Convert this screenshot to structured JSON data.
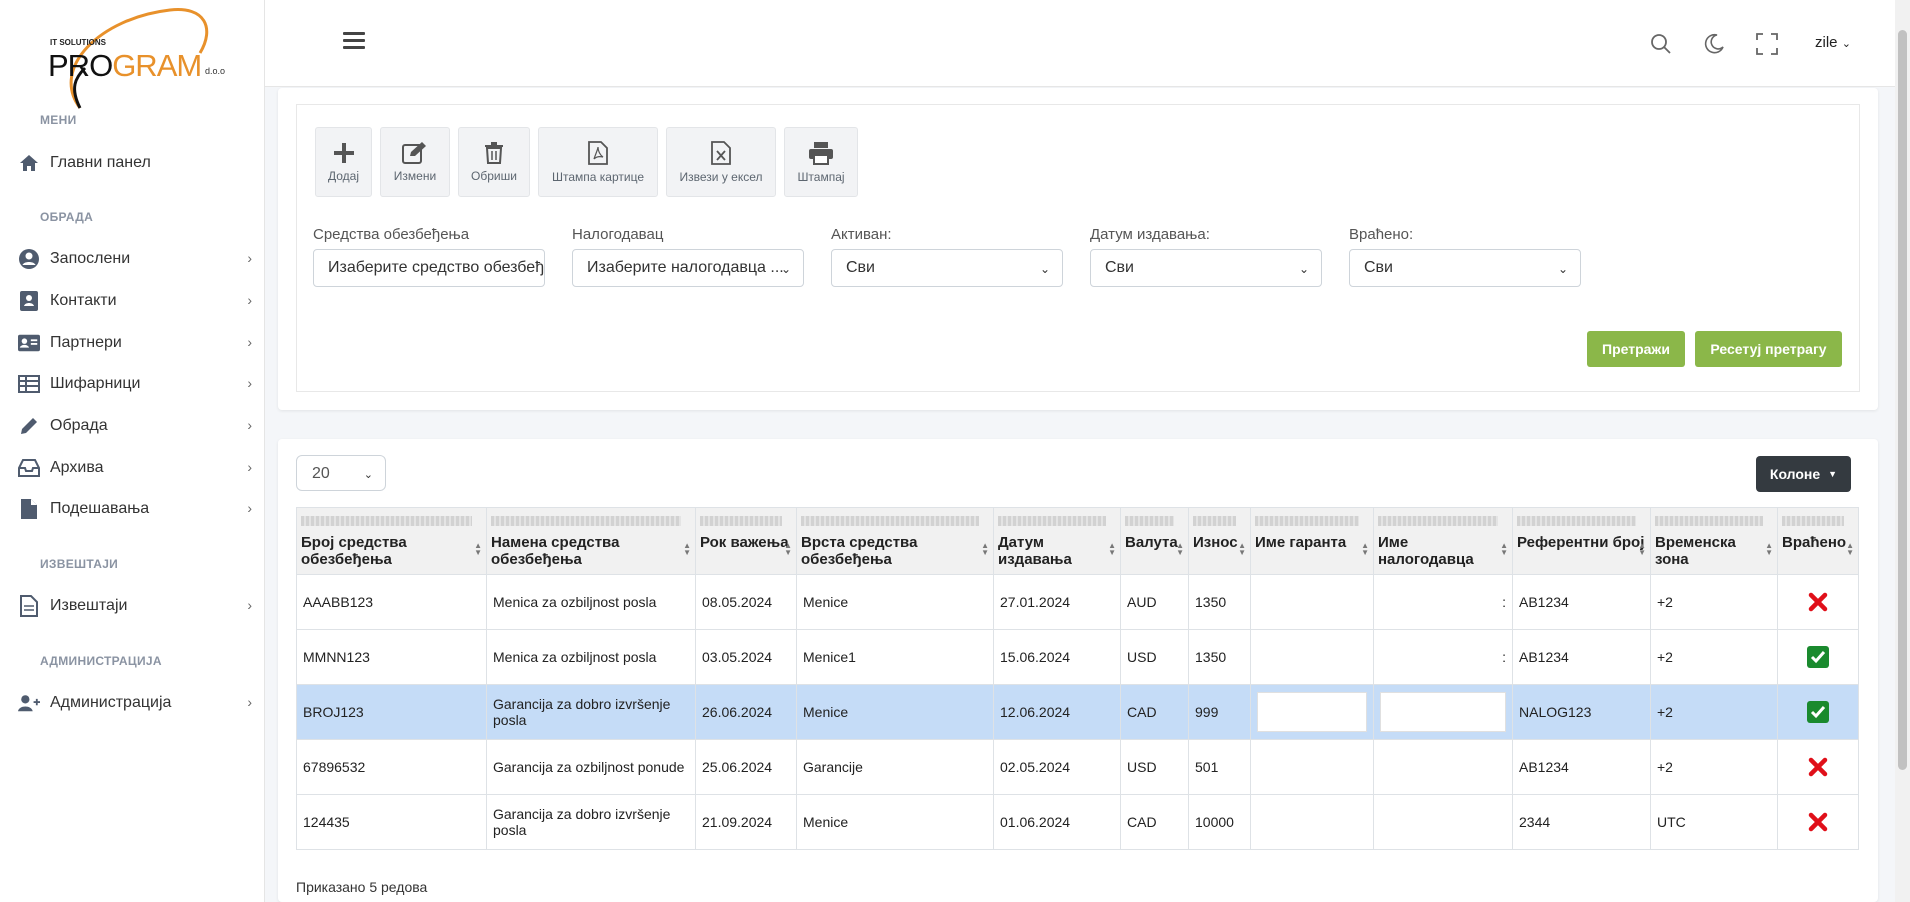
{
  "logo": {
    "small": "IT SOLUTIONS",
    "brand_pre": "PRO",
    "brand_post": "GRAM",
    "suffix": "d.o.o"
  },
  "sidebar": {
    "sections": [
      "МЕНИ",
      "ОБРАДА",
      "ИЗВЕШТАЈИ",
      "АДМИНИСТРАЦИЈА"
    ],
    "items": [
      {
        "label": "Главни панел",
        "icon": "home-icon"
      },
      {
        "label": "Запослени",
        "icon": "user-circle-icon"
      },
      {
        "label": "Контакти",
        "icon": "contact-icon"
      },
      {
        "label": "Партнери",
        "icon": "id-card-icon"
      },
      {
        "label": "Шифарници",
        "icon": "table-icon"
      },
      {
        "label": "Обрада",
        "icon": "pencil-icon"
      },
      {
        "label": "Архива",
        "icon": "inbox-icon"
      },
      {
        "label": "Подешавања",
        "icon": "file-icon"
      },
      {
        "label": "Извештаји",
        "icon": "report-icon"
      },
      {
        "label": "Администрација",
        "icon": "user-plus-icon"
      }
    ]
  },
  "topbar": {
    "user": "zile"
  },
  "toolbar": {
    "add": "Додај",
    "edit": "Измени",
    "delete": "Обриши",
    "print_card": "Штампа картице",
    "export_excel": "Извези у ексел",
    "print": "Штампај"
  },
  "filters": {
    "means": {
      "label": "Средства обезбеђења",
      "value": "Изаберите средство обезбеђења"
    },
    "principal": {
      "label": "Налогодавац",
      "value": "Изаберите налогодавца ..."
    },
    "active": {
      "label": "Активан:",
      "value": "Сви"
    },
    "issue_date": {
      "label": "Датум издавања:",
      "value": "Сви"
    },
    "returned": {
      "label": "Враћено:",
      "value": "Сви"
    },
    "search_btn": "Претражи",
    "reset_btn": "Ресетуј претрагу"
  },
  "table": {
    "page_size": "20",
    "columns_btn": "Колоне",
    "headers": [
      "Број средства обезбеђења",
      "Намена средства обезбеђења",
      "Рок важења",
      "Врста средства обезбеђења",
      "Датум издавања",
      "Валута",
      "Износ",
      "Име гаранта",
      "Име налогодавца",
      "Референтни број",
      "Временска зона",
      "Враћено"
    ],
    "rows": [
      [
        "AAABB123",
        "Menica za ozbiljnost posla",
        "08.05.2024",
        "Menice",
        "27.01.2024",
        "AUD",
        "1350",
        "",
        ":",
        "AB1234",
        "+2"
      ],
      [
        "MMNN123",
        "Menica za ozbiljnost posla",
        "03.05.2024",
        "Menice1",
        "15.06.2024",
        "USD",
        "1350",
        "",
        ":",
        "AB1234",
        "+2"
      ],
      [
        "BROJ123",
        "Garancija za dobro izvršenje posla",
        "26.06.2024",
        "Menice",
        "12.06.2024",
        "CAD",
        "999",
        "",
        "",
        "NALOG123",
        "+2"
      ],
      [
        "67896532",
        "Garancija za ozbiljnost ponude",
        "25.06.2024",
        "Garancije",
        "02.05.2024",
        "USD",
        "501",
        "",
        "",
        "AB1234",
        "+2"
      ],
      [
        "124435",
        "Garancija za dobro izvršenje posla",
        "21.09.2024",
        "Menice",
        "01.06.2024",
        "CAD",
        "10000",
        "",
        "",
        "2344",
        "UTC"
      ]
    ],
    "returned": [
      false,
      true,
      true,
      false,
      false
    ],
    "footer": "Приказано 5 редова"
  },
  "colors": {
    "accent_green": "#8bb749",
    "dark_button": "#343a40",
    "selected_row": "#c5dcf7",
    "returned_yes": "#1a8a2e",
    "returned_no": "#e0101a"
  }
}
